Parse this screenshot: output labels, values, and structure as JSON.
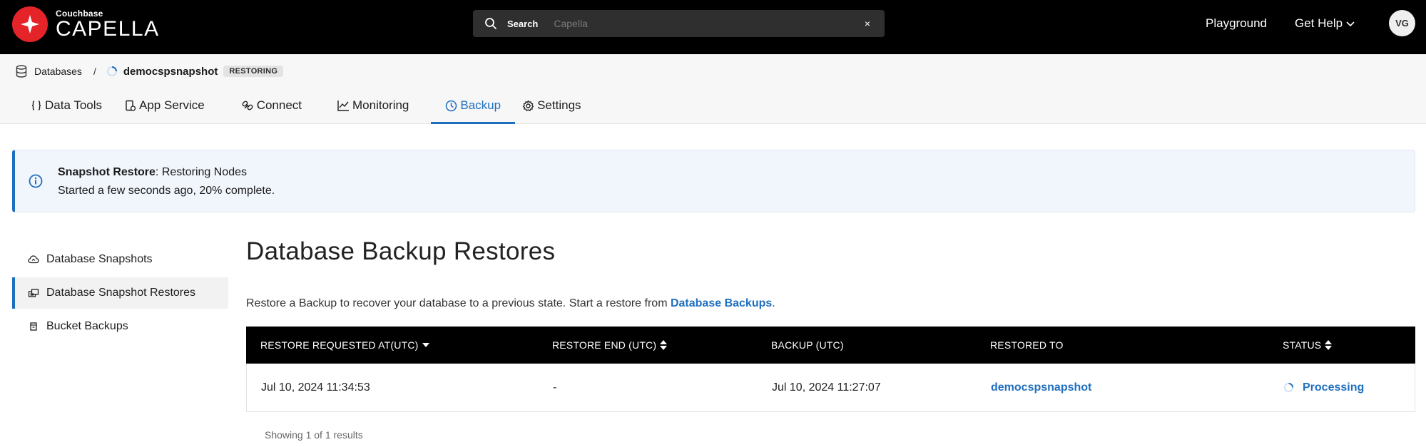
{
  "topbar": {
    "logo_small": "Couchbase",
    "logo_big": "CAPELLA",
    "search_label": "Search",
    "search_placeholder": "Capella",
    "search_clear": "×",
    "playground": "Playground",
    "get_help": "Get Help",
    "avatar_initials": "VG"
  },
  "breadcrumb": {
    "databases": "Databases",
    "separator": "/",
    "database_name": "democspsnapshot",
    "status_badge": "RESTORING"
  },
  "tabs": [
    {
      "label": "Data Tools",
      "icon": "braces-icon"
    },
    {
      "label": "App Service",
      "icon": "app-service-icon"
    },
    {
      "label": "Connect",
      "icon": "connect-icon"
    },
    {
      "label": "Monitoring",
      "icon": "chart-icon"
    },
    {
      "label": "Backup",
      "icon": "clock-icon",
      "active": true
    },
    {
      "label": "Settings",
      "icon": "gear-icon"
    }
  ],
  "banner": {
    "title": "Snapshot Restore",
    "title_suffix": ": Restoring Nodes",
    "progress_text": "Started a few seconds ago, 20% complete.",
    "progress_percent": 20
  },
  "sidenav": {
    "items": [
      {
        "label": "Database Snapshots",
        "icon": "cloud-icon"
      },
      {
        "label": "Database Snapshot Restores",
        "icon": "restore-icon",
        "active": true
      },
      {
        "label": "Bucket Backups",
        "icon": "bucket-icon"
      }
    ]
  },
  "main": {
    "title": "Database Backup Restores",
    "description_prefix": "Restore a Backup to recover your database to a previous state. Start a restore from ",
    "description_link": "Database Backups",
    "description_suffix": "."
  },
  "table": {
    "columns": [
      {
        "label": "RESTORE REQUESTED AT(UTC)",
        "sort": "desc"
      },
      {
        "label": "RESTORE END (UTC)",
        "sort": "both"
      },
      {
        "label": "BACKUP (UTC)",
        "sort": "none"
      },
      {
        "label": "RESTORED TO",
        "sort": "none"
      },
      {
        "label": "STATUS",
        "sort": "both"
      }
    ],
    "rows": [
      {
        "requested_at": "Jul 10, 2024 11:34:53",
        "end": "-",
        "backup": "Jul 10, 2024 11:27:07",
        "restored_to": "democspsnapshot",
        "status": "Processing"
      }
    ],
    "showing": "Showing 1 of 1 results"
  },
  "colors": {
    "accent": "#1f6fbf",
    "brand_red": "#e5242a",
    "topbar": "#000000"
  }
}
